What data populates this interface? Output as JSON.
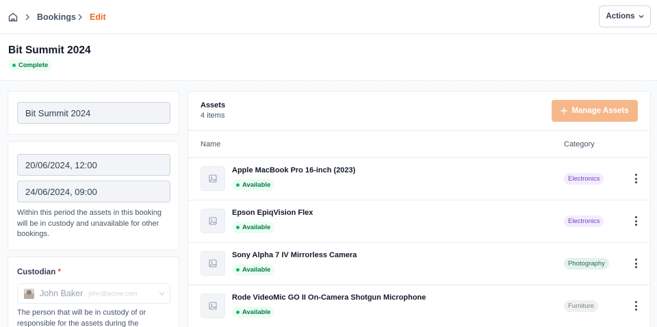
{
  "breadcrumb": {
    "home_icon": "home-icon",
    "items": [
      "Bookings",
      "Edit"
    ],
    "active_color": "#ef6820"
  },
  "header": {
    "actions_label": "Actions",
    "title": "Bit Summit 2024",
    "status": "Complete"
  },
  "form": {
    "name_value": "Bit Summit 2024",
    "start_date": "20/06/2024, 12:00",
    "end_date": "24/06/2024, 09:00",
    "period_help": "Within this period the assets in this booking will be in custody and unavailable for other bookings.",
    "custodian_label": "Custodian",
    "custodian_required": "*",
    "custodian_name": "John Baker",
    "custodian_email": "john@acme.com",
    "custodian_help": "The person that will be in custody of or responsible for the assets during the"
  },
  "assets": {
    "title": "Assets",
    "count": "4 items",
    "manage_label": "Manage Assets",
    "accent": "#f6b88a",
    "columns": {
      "name": "Name",
      "category": "Category"
    },
    "rows": [
      {
        "name": "Apple MacBook Pro 16-inch (2023)",
        "status": "Available",
        "category": "Electronics"
      },
      {
        "name": "Epson EpiqVision Flex",
        "status": "Available",
        "category": "Electronics"
      },
      {
        "name": "Sony Alpha 7 IV Mirrorless Camera",
        "status": "Available",
        "category": "Photography"
      },
      {
        "name": "Rode VideoMic GO II On-Camera Shotgun Microphone",
        "status": "Available",
        "category": "Furniture"
      }
    ]
  }
}
